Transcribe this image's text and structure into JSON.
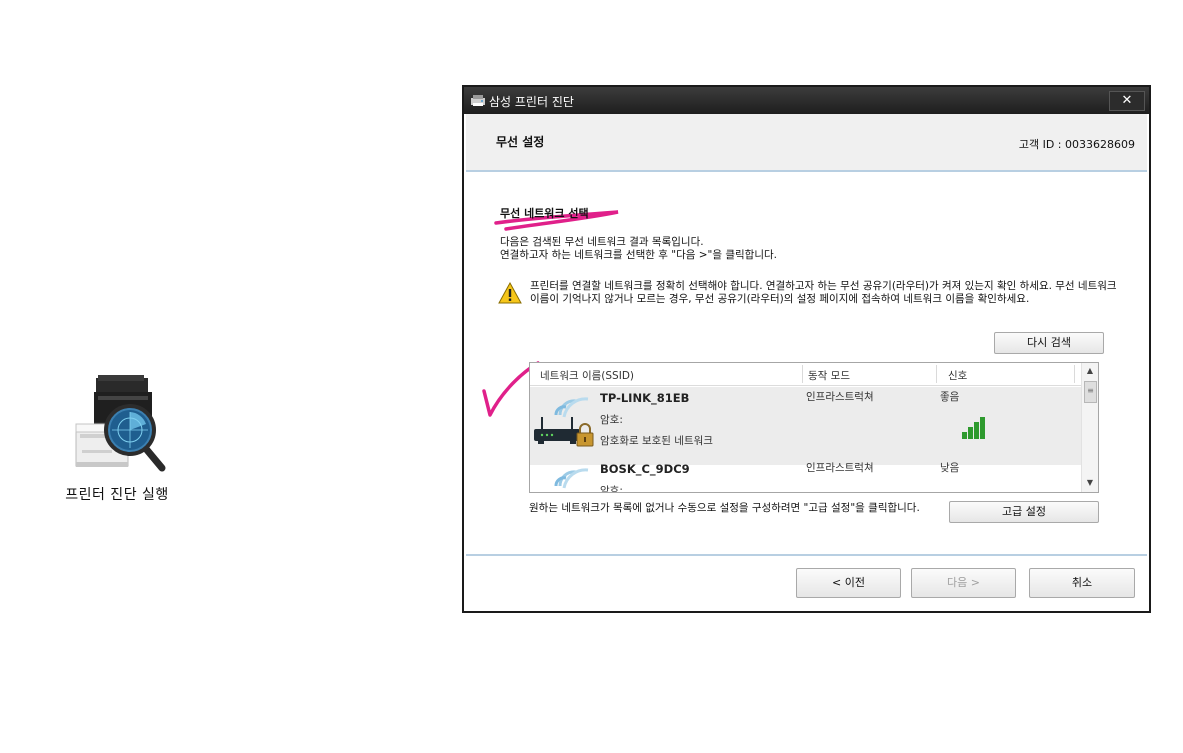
{
  "desktop": {
    "shortcut_label": "프린터 진단 실행",
    "shortcut_icon": "printer-diagnostics-icon"
  },
  "window": {
    "title": "삼성 프린터 진단",
    "close_label": "✕"
  },
  "header": {
    "page_title": "무선 설정",
    "customer_id": "고객 ID : 0033628609"
  },
  "content": {
    "section_title": "무선 네트워크 선택",
    "desc_line1": "다음은 검색된 무선 네트워크 결과 목록입니다.",
    "desc_line2": "연결하고자 하는 네트워크를 선택한 후 \"다음 >\"을 클릭합니다.",
    "warning": "프린터를 연결할 네트워크를 정확히 선택해야 합니다. 연결하고자 하는 무선 공유기(라우터)가 켜져 있는지 확인 하세요. 무선 네트워크 이름이 기억나지 않거나 모르는 경우, 무선 공유기(라우터)의 설정 페이지에 접속하여 네트워크 이름을 확인하세요.",
    "rescan_label": "다시 검색",
    "manual_text": "원하는 네트워크가 목록에 없거나 수동으로 설정을 구성하려면 \"고급 설정\"을 클릭합니다.",
    "advanced_label": "고급 설정"
  },
  "network_list": {
    "columns": [
      "네트워크 이름(SSID)",
      "동작 모드",
      "신호"
    ],
    "rows": [
      {
        "ssid": "TP-LINK_81EB",
        "encryption_label": "암호:",
        "encryption_status": "암호화로 보호된 네트워크",
        "mode": "인프라스트럭쳐",
        "signal": "좋음",
        "signal_bars": 4,
        "selected": true
      },
      {
        "ssid": "BOSK_C_9DC9",
        "encryption_label": "암호:",
        "encryption_status": "",
        "mode": "인프라스트럭쳐",
        "signal": "낮음",
        "signal_bars": 1,
        "selected": false
      }
    ]
  },
  "footer": {
    "prev_label": "< 이전",
    "next_label": "다음 >",
    "cancel_label": "취소"
  },
  "colors": {
    "annotation": "#e0208a",
    "signal_green": "#2e9a2e",
    "rule_blue": "#b8cfe2"
  }
}
